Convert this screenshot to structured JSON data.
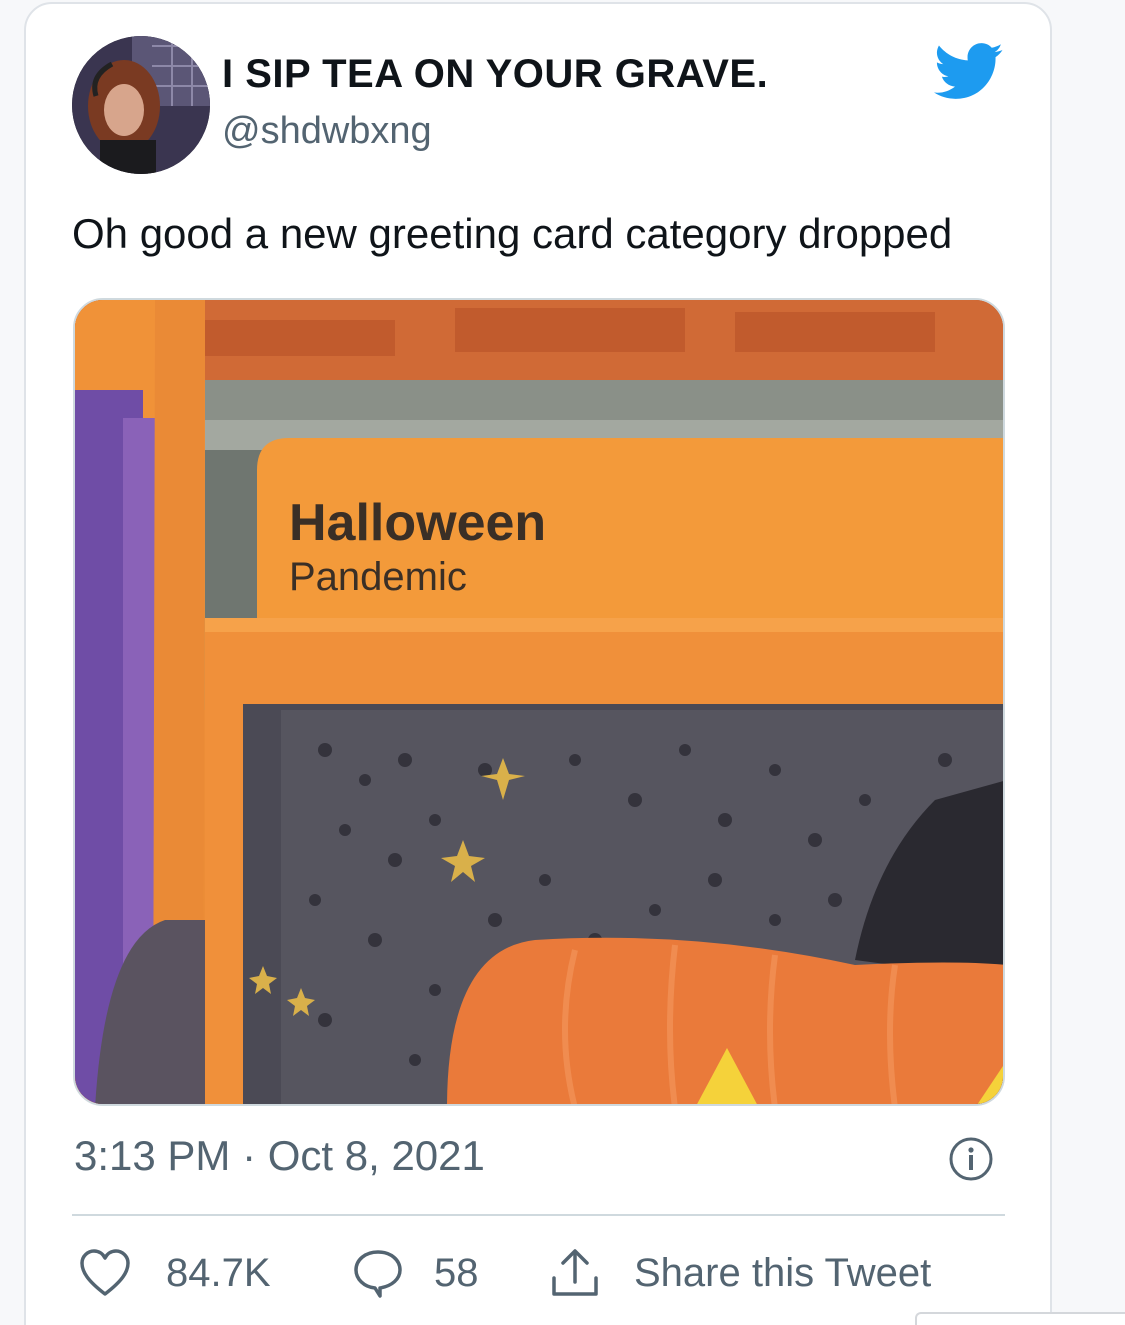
{
  "tweet": {
    "display_name": "I SIP TEA ON YOUR GRAVE.",
    "handle": "@shdwbxng",
    "text": "Oh good a new greeting card category dropped",
    "image": {
      "card_heading": "Halloween",
      "card_subheading": "Pandemic"
    },
    "timestamp": "3:13 PM · Oct 8, 2021",
    "likes": "84.7K",
    "replies": "58",
    "share_label": "Share this Tweet"
  },
  "icons": {
    "brand": "twitter-bird-icon",
    "like": "heart-icon",
    "reply": "speech-bubble-icon",
    "share": "share-upload-icon",
    "info": "info-icon"
  },
  "colors": {
    "twitter_blue": "#1d9bf0",
    "text_primary": "#0f1419",
    "text_secondary": "#536471",
    "border": "#cfd9de"
  }
}
